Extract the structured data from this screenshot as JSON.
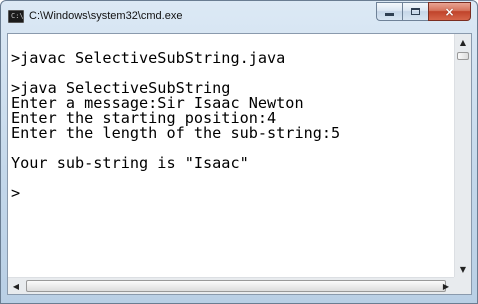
{
  "window": {
    "title": "C:\\Windows\\system32\\cmd.exe",
    "icon": "cmd-icon",
    "close_glyph": "×"
  },
  "console": {
    "lines": [
      ">javac SelectiveSubString.java",
      "",
      ">java SelectiveSubString",
      "Enter a message:Sir Isaac Newton",
      "Enter the starting position:4",
      "Enter the length of the sub-string:5",
      "",
      "Your sub-string is \"Isaac\"",
      "",
      ">"
    ]
  },
  "scrollbars": {
    "up_arrow": "▲",
    "down_arrow": "▼",
    "left_arrow": "◀",
    "right_arrow": "▶"
  }
}
